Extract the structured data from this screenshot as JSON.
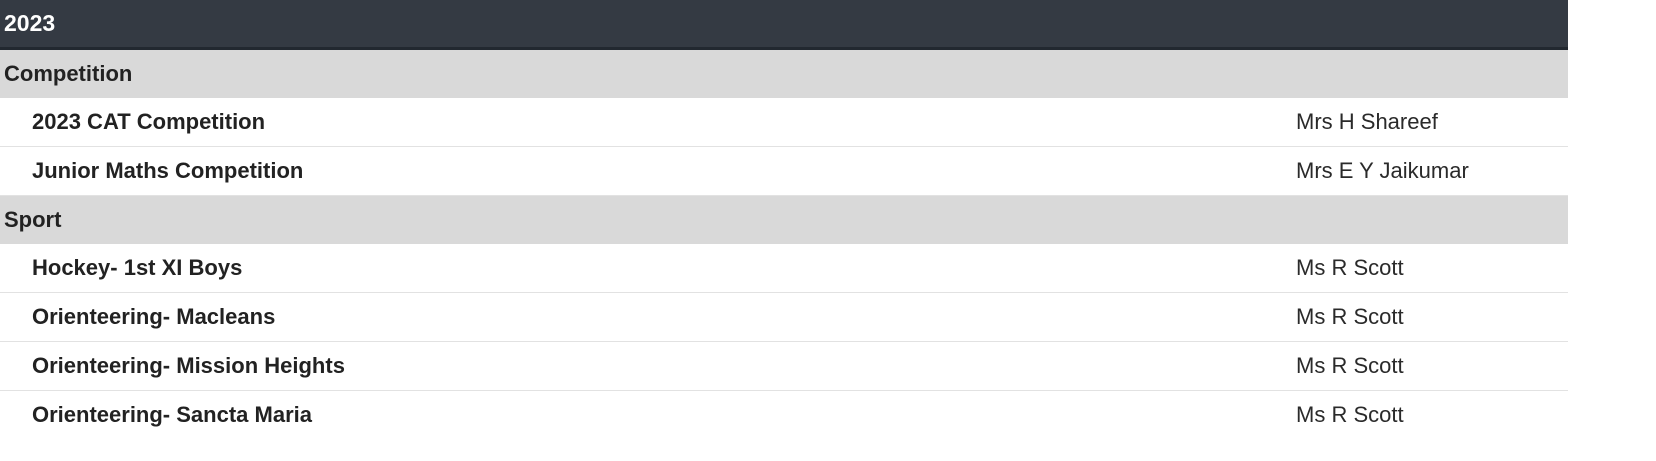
{
  "year": "2023",
  "groups": [
    {
      "name": "Competition",
      "rows": [
        {
          "title": "2023 CAT Competition",
          "staff": "Mrs H Shareef"
        },
        {
          "title": "Junior Maths Competition",
          "staff": "Mrs E Y Jaikumar"
        }
      ]
    },
    {
      "name": "Sport",
      "rows": [
        {
          "title": "Hockey- 1st XI Boys",
          "staff": "Ms R Scott"
        },
        {
          "title": "Orienteering- Macleans",
          "staff": "Ms R Scott"
        },
        {
          "title": "Orienteering- Mission Heights",
          "staff": "Ms R Scott"
        },
        {
          "title": "Orienteering- Sancta Maria",
          "staff": "Ms R Scott"
        }
      ]
    }
  ],
  "colors": {
    "header_bg": "#343a43",
    "group_bg": "#d9d9d9",
    "row_divider": "#e2e2e2"
  }
}
